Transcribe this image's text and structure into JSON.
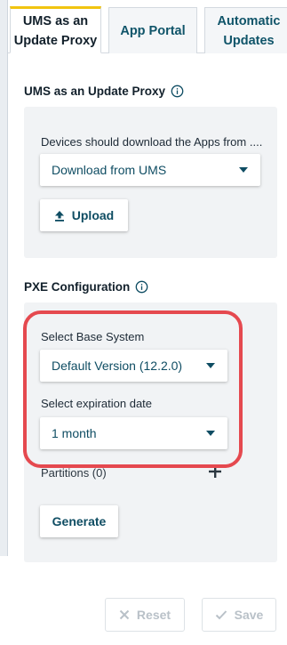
{
  "tabs": [
    {
      "label": "UMS as an\nUpdate Proxy",
      "active": true
    },
    {
      "label": "App Portal",
      "active": false
    },
    {
      "label": "Automatic\nUpdates",
      "active": false
    }
  ],
  "update_proxy": {
    "title": "UMS as an Update Proxy",
    "download_label": "Devices should download the Apps from ....",
    "download_value": "Download from UMS",
    "upload_label": "Upload"
  },
  "pxe": {
    "title": "PXE Configuration",
    "base_system_label": "Select Base System",
    "base_system_value": "Default Version (12.2.0)",
    "expiration_label": "Select expiration date",
    "expiration_value": "1 month",
    "partitions_label": "Partitions (0)",
    "generate_label": "Generate"
  },
  "footer": {
    "reset_label": "Reset",
    "save_label": "Save"
  },
  "colors": {
    "accent": "#0f4d63",
    "active_tab_marker": "#f1c40f",
    "highlight": "#e5494f"
  }
}
